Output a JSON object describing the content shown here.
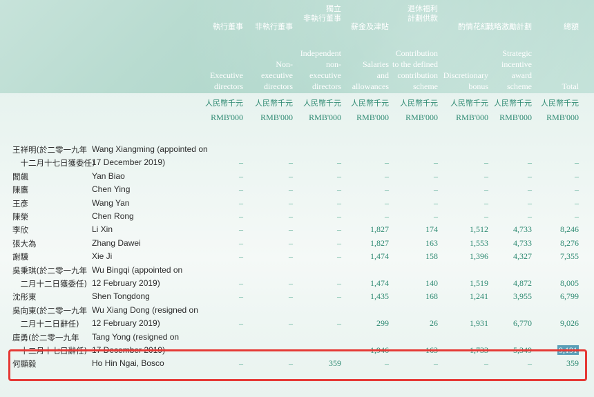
{
  "columns": [
    {
      "zh": "執行董事",
      "en": "Executive\ndirectors",
      "unit_zh": "人民幣千元",
      "unit_en": "RMB'000"
    },
    {
      "zh": "非執行董事",
      "en": "Non-\nexecutive\ndirectors",
      "unit_zh": "人民幣千元",
      "unit_en": "RMB'000"
    },
    {
      "zh": "獨立\n非執行董事",
      "en": "Independent\nnon-\nexecutive\ndirectors",
      "unit_zh": "人民幣千元",
      "unit_en": "RMB'000"
    },
    {
      "zh": "薪金及津貼",
      "en": "Salaries\nand\nallowances",
      "unit_zh": "人民幣千元",
      "unit_en": "RMB'000"
    },
    {
      "zh": "退休福利\n計劃供款",
      "en": "Contribution\nto the defined\ncontribution\nscheme",
      "unit_zh": "人民幣千元",
      "unit_en": "RMB'000"
    },
    {
      "zh": "酌情花紅",
      "en": "Discretionary\nbonus",
      "unit_zh": "人民幣千元",
      "unit_en": "RMB'000"
    },
    {
      "zh": "戰略激勵計劃",
      "en": "Strategic\nincentive\naward\nscheme",
      "unit_zh": "人民幣千元",
      "unit_en": "RMB'000"
    },
    {
      "zh": "總額",
      "en": "Total",
      "unit_zh": "人民幣千元",
      "unit_en": "RMB'000"
    }
  ],
  "rows": [
    {
      "zh": "王祥明(於二零一九年",
      "en": "Wang Xiangming (appointed on",
      "values": []
    },
    {
      "zh": "　十二月十七日獲委任)",
      "en": "17 December 2019)",
      "values": [
        "–",
        "–",
        "–",
        "–",
        "–",
        "–",
        "–",
        "–"
      ]
    },
    {
      "zh": "閻飆",
      "en": "Yan Biao",
      "values": [
        "–",
        "–",
        "–",
        "–",
        "–",
        "–",
        "–",
        "–"
      ]
    },
    {
      "zh": "陳鷹",
      "en": "Chen Ying",
      "values": [
        "–",
        "–",
        "–",
        "–",
        "–",
        "–",
        "–",
        "–"
      ]
    },
    {
      "zh": "王彥",
      "en": "Wang Yan",
      "values": [
        "–",
        "–",
        "–",
        "–",
        "–",
        "–",
        "–",
        "–"
      ]
    },
    {
      "zh": "陳榮",
      "en": "Chen Rong",
      "values": [
        "–",
        "–",
        "–",
        "–",
        "–",
        "–",
        "–",
        "–"
      ]
    },
    {
      "zh": "李欣",
      "en": "Li Xin",
      "values": [
        "–",
        "–",
        "–",
        "1,827",
        "174",
        "1,512",
        "4,733",
        "8,246"
      ]
    },
    {
      "zh": "張大為",
      "en": "Zhang Dawei",
      "values": [
        "–",
        "–",
        "–",
        "1,827",
        "163",
        "1,553",
        "4,733",
        "8,276"
      ]
    },
    {
      "zh": "謝驥",
      "en": "Xie Ji",
      "values": [
        "–",
        "–",
        "–",
        "1,474",
        "158",
        "1,396",
        "4,327",
        "7,355"
      ]
    },
    {
      "zh": "吳秉琪(於二零一九年",
      "en": "Wu Bingqi (appointed on",
      "values": []
    },
    {
      "zh": "　二月十二日獲委任)",
      "en": "12 February 2019)",
      "values": [
        "–",
        "–",
        "–",
        "1,474",
        "140",
        "1,519",
        "4,872",
        "8,005"
      ]
    },
    {
      "zh": "沈彤東",
      "en": "Shen Tongdong",
      "values": [
        "–",
        "–",
        "–",
        "1,435",
        "168",
        "1,241",
        "3,955",
        "6,799"
      ]
    },
    {
      "zh": "吳向東(於二零一九年",
      "en": "Wu Xiang Dong (resigned on",
      "values": []
    },
    {
      "zh": "　二月十二日辭任)",
      "en": "12 February 2019)",
      "values": [
        "–",
        "–",
        "–",
        "299",
        "26",
        "1,931",
        "6,770",
        "9,026"
      ]
    },
    {
      "zh": "唐勇(於二零一九年",
      "en": "Tang Yong (resigned on",
      "values": []
    },
    {
      "zh": "　十二月十七日辭任)",
      "en": "17 December 2019)",
      "values": [
        "–",
        "–",
        "–",
        "1,946",
        "163",
        "1,733",
        "5,349",
        "9,191"
      ]
    },
    {
      "zh": "何顯毅",
      "en": "Ho Hin Ngai, Bosco",
      "values": [
        "–",
        "–",
        "359",
        "–",
        "–",
        "–",
        "–",
        "359"
      ]
    }
  ],
  "colors": {
    "header_bg": "#b8dbd0",
    "value_text": "#2e8a72",
    "highlight_border": "#e53935"
  }
}
